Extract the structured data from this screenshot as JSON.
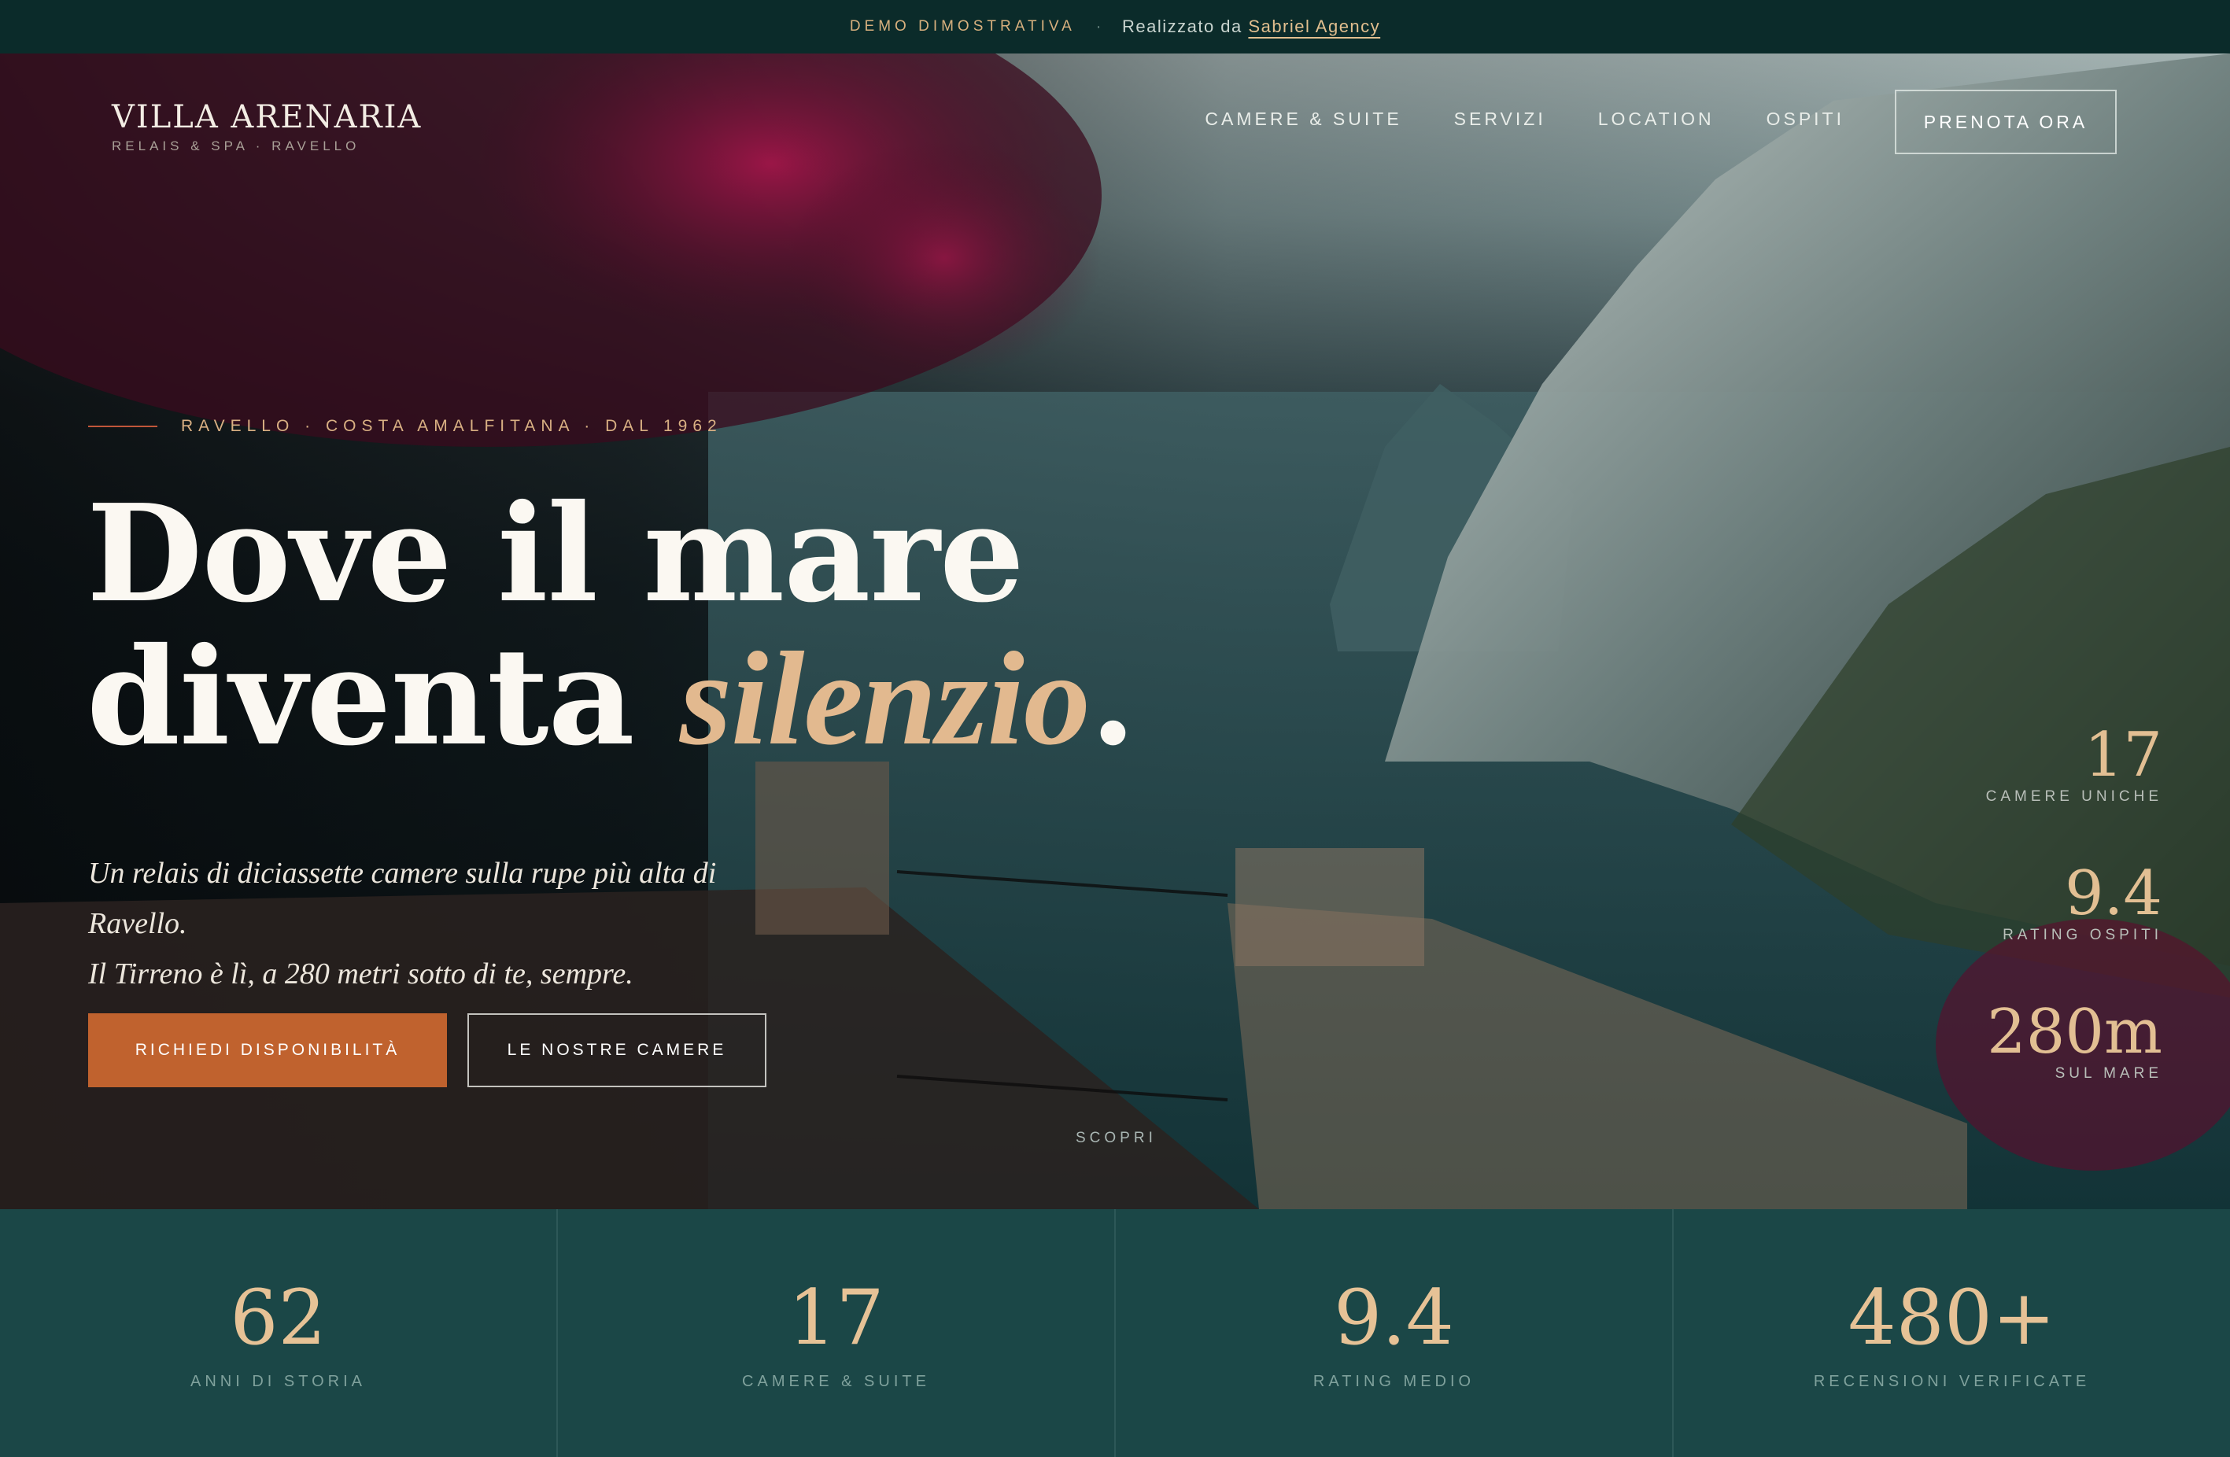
{
  "demo_bar": {
    "tag": "DEMO DIMOSTRATIVA",
    "separator": "·",
    "made_by": "Realizzato da",
    "agency": "Sabriel Agency"
  },
  "brand": {
    "name": "VILLA ARENARIA",
    "subtitle": "RELAIS & SPA · RAVELLO"
  },
  "nav": {
    "items": [
      "CAMERE & SUITE",
      "SERVIZI",
      "LOCATION",
      "OSPITI"
    ],
    "cta": "PRENOTA ORA"
  },
  "hero": {
    "eyebrow": "RAVELLO · COSTA AMALFITANA · DAL 1962",
    "headline_line1": "Dove il mare",
    "headline_line2_start": "diventa",
    "headline_accent": "silenzio",
    "headline_end": ".",
    "tagline_line1": "Un relais di diciassette camere sulla rupe più alta di",
    "tagline_line2": "Ravello.",
    "tagline_line3": "Il Tirreno è lì, a 280 metri sotto di te, sempre.",
    "primary_button": "RICHIEDI DISPONIBILITÀ",
    "secondary_button": "LE NOSTRE CAMERE",
    "scroll_cue": "SCOPRI"
  },
  "side_stats": [
    {
      "value": "17",
      "label": "CAMERE UNICHE"
    },
    {
      "value": "9.4",
      "label": "RATING OSPITI"
    },
    {
      "value": "280m",
      "label": "SUL MARE"
    }
  ],
  "stats": [
    {
      "value": "62",
      "label": "ANNI DI STORIA"
    },
    {
      "value": "17",
      "label": "CAMERE & SUITE"
    },
    {
      "value": "9.4",
      "label": "RATING MEDIO"
    },
    {
      "value": "480+",
      "label": "RECENSIONI VERIFICATE"
    }
  ],
  "colors": {
    "accent": "#c0622e",
    "gold": "#e2bf93",
    "band": "#1b4747"
  }
}
